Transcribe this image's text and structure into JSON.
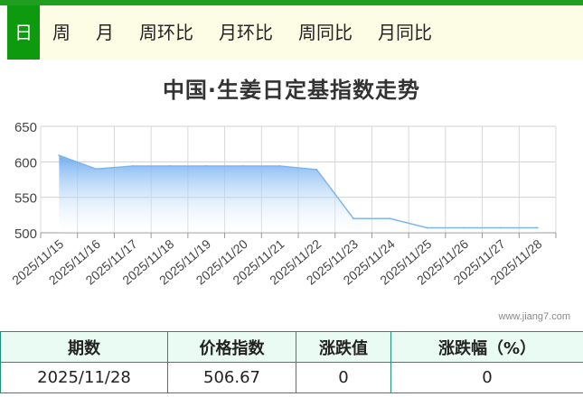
{
  "tabs": [
    "日",
    "周",
    "月",
    "周环比",
    "月环比",
    "周同比",
    "月同比"
  ],
  "active_tab": 0,
  "watermark": "www.jiang7.com",
  "table": {
    "headers": [
      "期数",
      "价格指数",
      "涨跌值",
      "涨跌幅（%）"
    ],
    "row": [
      "2025/11/28",
      "506.67",
      "0",
      "0"
    ]
  },
  "colors": {
    "accent": "#0e9a0e",
    "line": "#7fb6ea",
    "fill": "#6aaaf0"
  },
  "chart_data": {
    "type": "area",
    "title": "中国·生姜日定基指数走势",
    "x": [
      "2025/11/15",
      "2025/11/16",
      "2025/11/17",
      "2025/11/18",
      "2025/11/19",
      "2025/11/20",
      "2025/11/21",
      "2025/11/22",
      "2025/11/23",
      "2025/11/24",
      "2025/11/25",
      "2025/11/26",
      "2025/11/27",
      "2025/11/28"
    ],
    "values": [
      609,
      590,
      594,
      594,
      594,
      594,
      594,
      589,
      520,
      520,
      507,
      507,
      507,
      507
    ],
    "ylim": [
      500,
      650
    ],
    "yticks": [
      500,
      550,
      600,
      650
    ],
    "grid": true
  }
}
